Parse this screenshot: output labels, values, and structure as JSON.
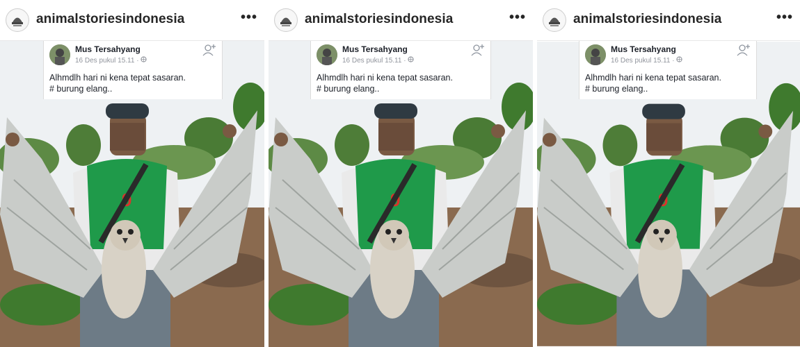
{
  "posts": [
    {
      "instagram": {
        "username": "animalstoriesindonesia",
        "more_icon": "•••"
      },
      "facebook": {
        "name": "Mus Tersahyang",
        "timestamp": "16 Des pukul 15.11",
        "separator": "·",
        "caption_line1": "Alhmdlh hari ni kena tepat sasaran.",
        "caption_line2": "# burung elang.."
      }
    },
    {
      "instagram": {
        "username": "animalstoriesindonesia",
        "more_icon": "•••"
      },
      "facebook": {
        "name": "Mus Tersahyang",
        "timestamp": "16 Des pukul 15.11",
        "separator": "·",
        "caption_line1": "Alhmdlh hari ni kena tepat sasaran.",
        "caption_line2": "# burung elang.."
      }
    },
    {
      "instagram": {
        "username": "animalstoriesindonesia",
        "more_icon": "•••"
      },
      "facebook": {
        "name": "Mus Tersahyang",
        "timestamp": "16 Des pukul 15.11",
        "separator": "·",
        "caption_line1": "Alhmdlh hari ni kena tepat sasaran.",
        "caption_line2": "# burung elang.."
      }
    }
  ],
  "colors": {
    "jersey": "#1f9a4a",
    "sky": "#eef1f3",
    "ground": "#8a6a4f",
    "foliage": "#3f7a2e",
    "wing": "#c9ccc9"
  },
  "icons": [
    "profile-avatar-icon",
    "more-options-icon",
    "globe-icon",
    "add-friend-icon"
  ]
}
